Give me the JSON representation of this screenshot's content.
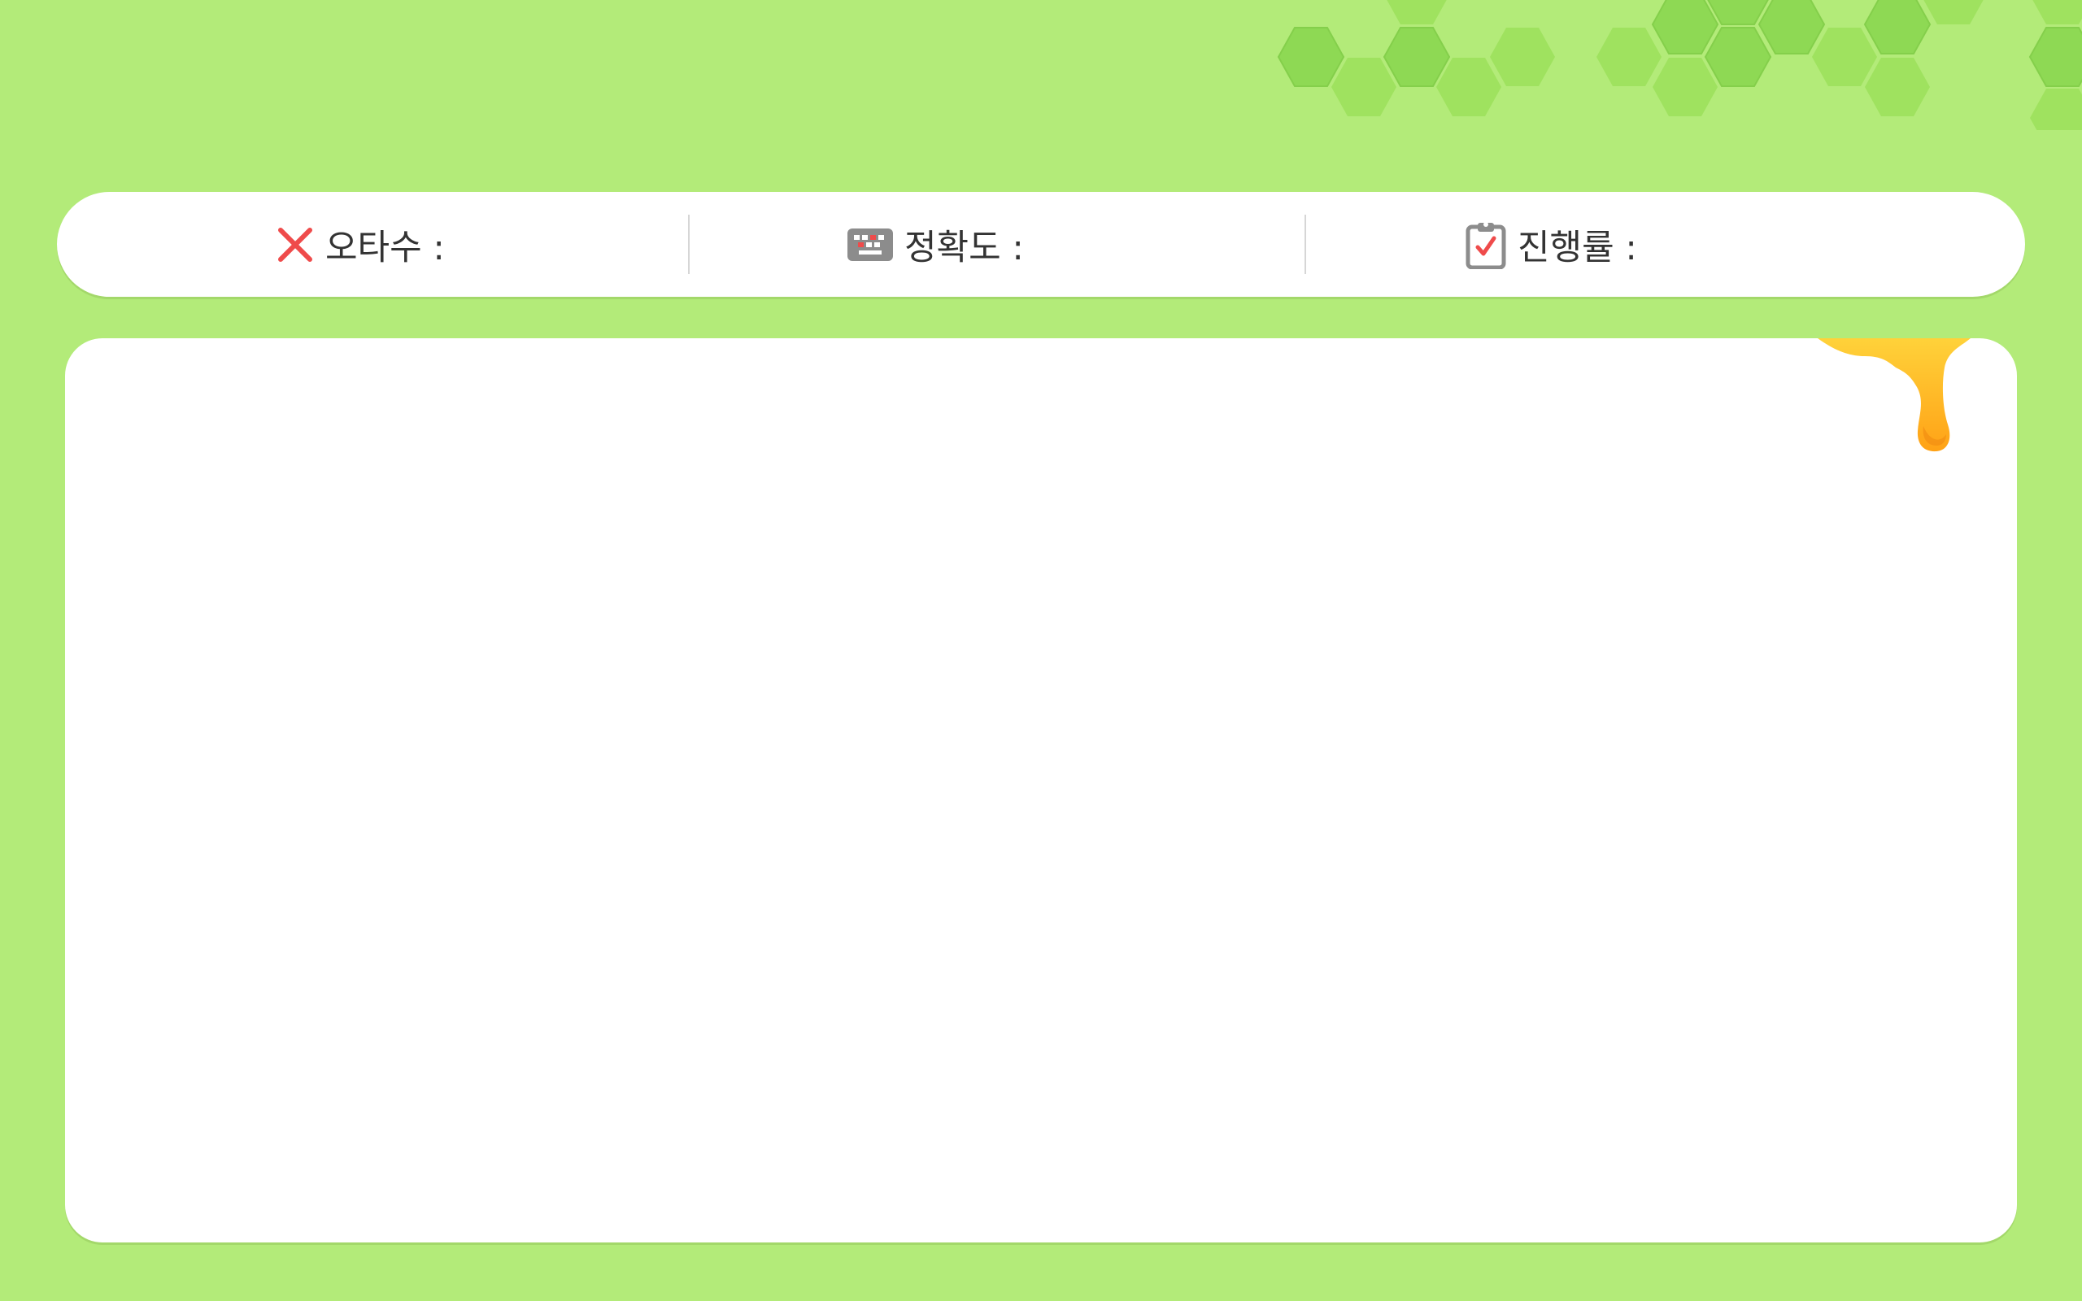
{
  "colors": {
    "background": "#b3eb79",
    "hex_dark": "#8ed954",
    "hex_light": "#9fe25f",
    "panel": "#ffffff",
    "error_red": "#ef4b4b",
    "honey": "#ffb928"
  },
  "stats": {
    "errors": {
      "icon": "x-icon",
      "label": "오타수 :"
    },
    "accuracy": {
      "icon": "keyboard-icon",
      "label": "정확도 :"
    },
    "progress": {
      "icon": "clipboard-check-icon",
      "label": "진행률 :"
    }
  }
}
